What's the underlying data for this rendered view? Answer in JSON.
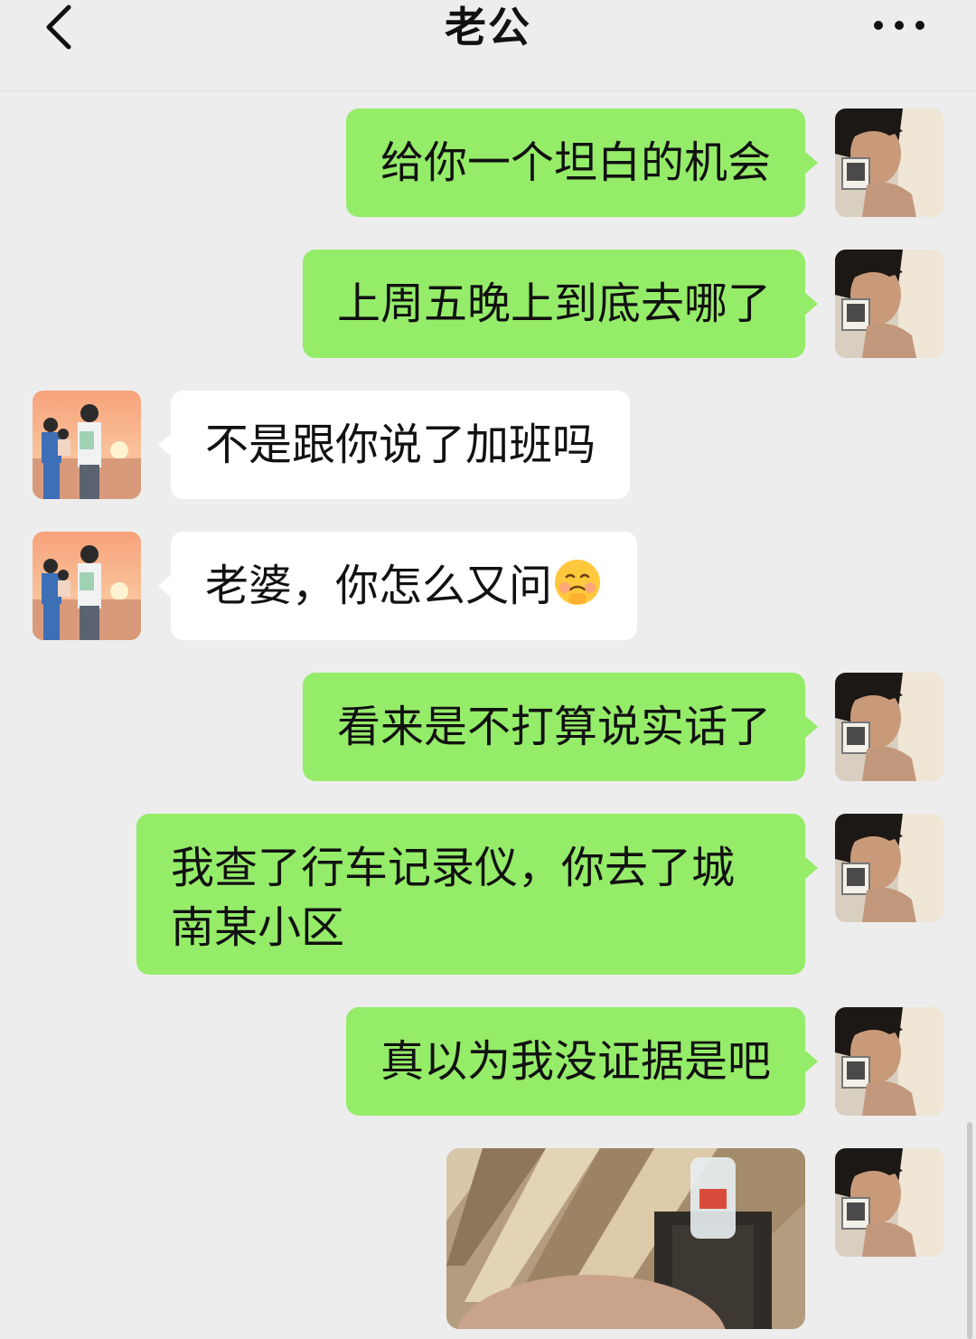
{
  "header": {
    "title": "老公"
  },
  "messages": [
    {
      "from": "me",
      "text": "给你一个坦白的机会"
    },
    {
      "from": "me",
      "text": "上周五晚上到底去哪了"
    },
    {
      "from": "him",
      "text": "不是跟你说了加班吗"
    },
    {
      "from": "him",
      "text": "老婆，你怎么又问",
      "emoji": "pleading-face-icon"
    },
    {
      "from": "me",
      "text": "看来是不打算说实话了"
    },
    {
      "from": "me",
      "text": "我查了行车记录仪，你去了城\n南某小区"
    },
    {
      "from": "me",
      "text": "真以为我没证据是吧"
    },
    {
      "from": "me",
      "type": "image"
    }
  ],
  "colors": {
    "background": "#ededed",
    "my_bubble": "#95ec69",
    "his_bubble": "#ffffff"
  }
}
